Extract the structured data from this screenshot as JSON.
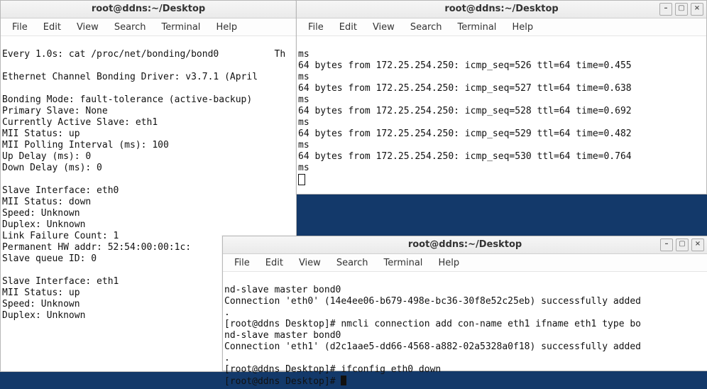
{
  "menus": {
    "file": "File",
    "edit": "Edit",
    "view": "View",
    "search": "Search",
    "terminal": "Terminal",
    "help": "Help"
  },
  "window1": {
    "title": "root@ddns:~/Desktop",
    "lines": [
      "Every 1.0s: cat /proc/net/bonding/bond0          Th",
      "",
      "Ethernet Channel Bonding Driver: v3.7.1 (April",
      "",
      "Bonding Mode: fault-tolerance (active-backup)",
      "Primary Slave: None",
      "Currently Active Slave: eth1",
      "MII Status: up",
      "MII Polling Interval (ms): 100",
      "Up Delay (ms): 0",
      "Down Delay (ms): 0",
      "",
      "Slave Interface: eth0",
      "MII Status: down",
      "Speed: Unknown",
      "Duplex: Unknown",
      "Link Failure Count: 1",
      "Permanent HW addr: 52:54:00:00:1c:",
      "Slave queue ID: 0",
      "",
      "Slave Interface: eth1",
      "MII Status: up",
      "Speed: Unknown",
      "Duplex: Unknown"
    ]
  },
  "window2": {
    "title": "root@ddns:~/Desktop",
    "lines": [
      "ms",
      "64 bytes from 172.25.254.250: icmp_seq=526 ttl=64 time=0.455 ",
      "ms",
      "64 bytes from 172.25.254.250: icmp_seq=527 ttl=64 time=0.638 ",
      "ms",
      "64 bytes from 172.25.254.250: icmp_seq=528 ttl=64 time=0.692 ",
      "ms",
      "64 bytes from 172.25.254.250: icmp_seq=529 ttl=64 time=0.482 ",
      "ms",
      "64 bytes from 172.25.254.250: icmp_seq=530 ttl=64 time=0.764 ",
      "ms"
    ]
  },
  "window3": {
    "title": "root@ddns:~/Desktop",
    "lines": [
      "nd-slave master bond0",
      "Connection 'eth0' (14e4ee06-b679-498e-bc36-30f8e52c25eb) successfully added",
      ".",
      "[root@ddns Desktop]# nmcli connection add con-name eth1 ifname eth1 type bo",
      "nd-slave master bond0",
      "Connection 'eth1' (d2c1aae5-dd66-4568-a882-02a5328a0f18) successfully added",
      ".",
      "[root@ddns Desktop]# ifconfig eth0 down",
      "[root@ddns Desktop]# "
    ]
  }
}
